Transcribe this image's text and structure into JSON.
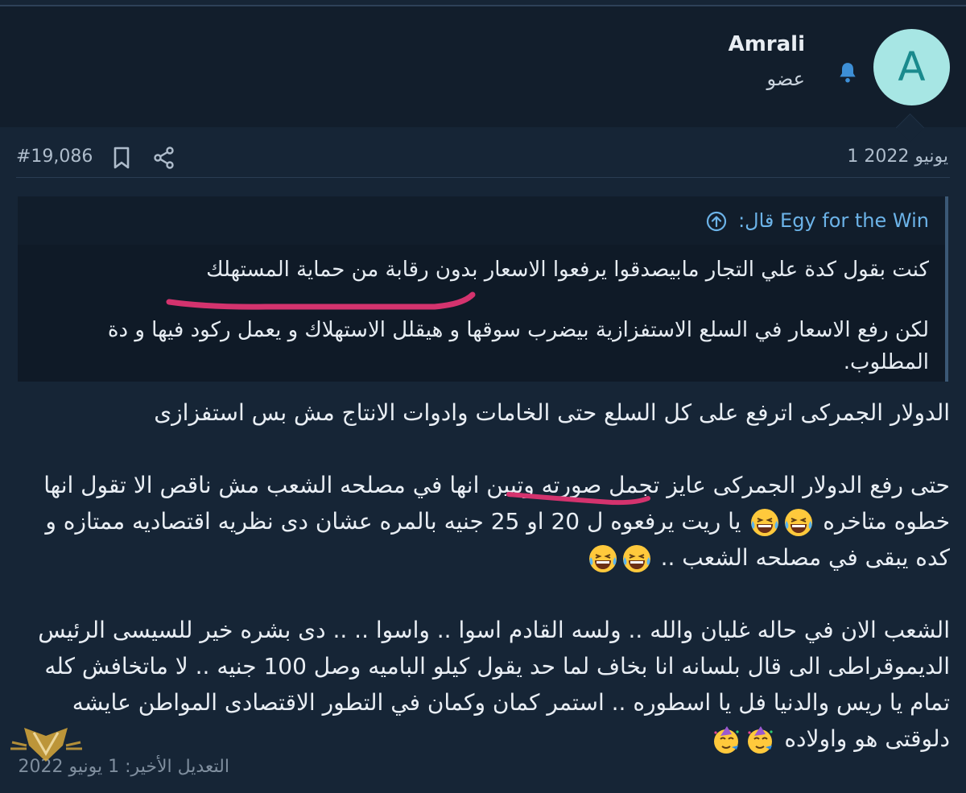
{
  "user": {
    "name": "Amrali",
    "title": "عضو",
    "avatar_letter": "A"
  },
  "post": {
    "number": "#19,086",
    "date": "1 يونيو 2022",
    "quote": {
      "attribution": "Egy for the Win قال:",
      "line1": "كنت بقول كدة علي التجار مابيصدقوا يرفعوا الاسعار بدون رقابة من حماية المستهلك",
      "line2": "لكن رفع الاسعار في السلع الاستفزازية بيضرب سوقها و هيقلل الاستهلاك و يعمل ركود فيها و دة المطلوب."
    },
    "body": {
      "para1": "الدولار الجمركى اترفع على كل السلع حتى الخامات وادوات الانتاج مش بس استفزازى",
      "para2a": "حتى رفع الدولار الجمركى عايز تجمل صورته وتبين انها في مصلحه الشعب مش ناقص الا تقول انها خطوه متاخره",
      "para2b": "يا ريت يرفعوه ل 20 او 25 جنيه بالمره عشان دى نظريه اقتصاديه ممتازه و كده يبقى في مصلحه الشعب ..",
      "para3": "الشعب الان في حاله غليان والله .. ولسه القادم اسوا .. واسوا .. .. دى بشره خير للسيسى الرئيس الديموقراطى الى قال بلسانه انا بخاف لما حد يقول كيلو الباميه وصل 100 جنيه .. لا ماتخافش كله تمام يا ريس والدنيا فل يا اسطوره .. استمر كمان وكمان في التطور الاقتصادى المواطن عايشه دلوقتى هو واولاده"
    },
    "edited": "التعديل الأخير: 1 يونيو 2022"
  },
  "colors": {
    "background": "#162536",
    "header": "#121e2c",
    "accent": "#6cb3e8",
    "highlight_underline": "#d4336e",
    "avatar": "#a7e6e4"
  },
  "icons": [
    "bell-icon",
    "bookmark-icon",
    "share-icon",
    "arrow-up-circle-icon",
    "laughing-emoji-icon",
    "party-face-emoji-icon"
  ]
}
